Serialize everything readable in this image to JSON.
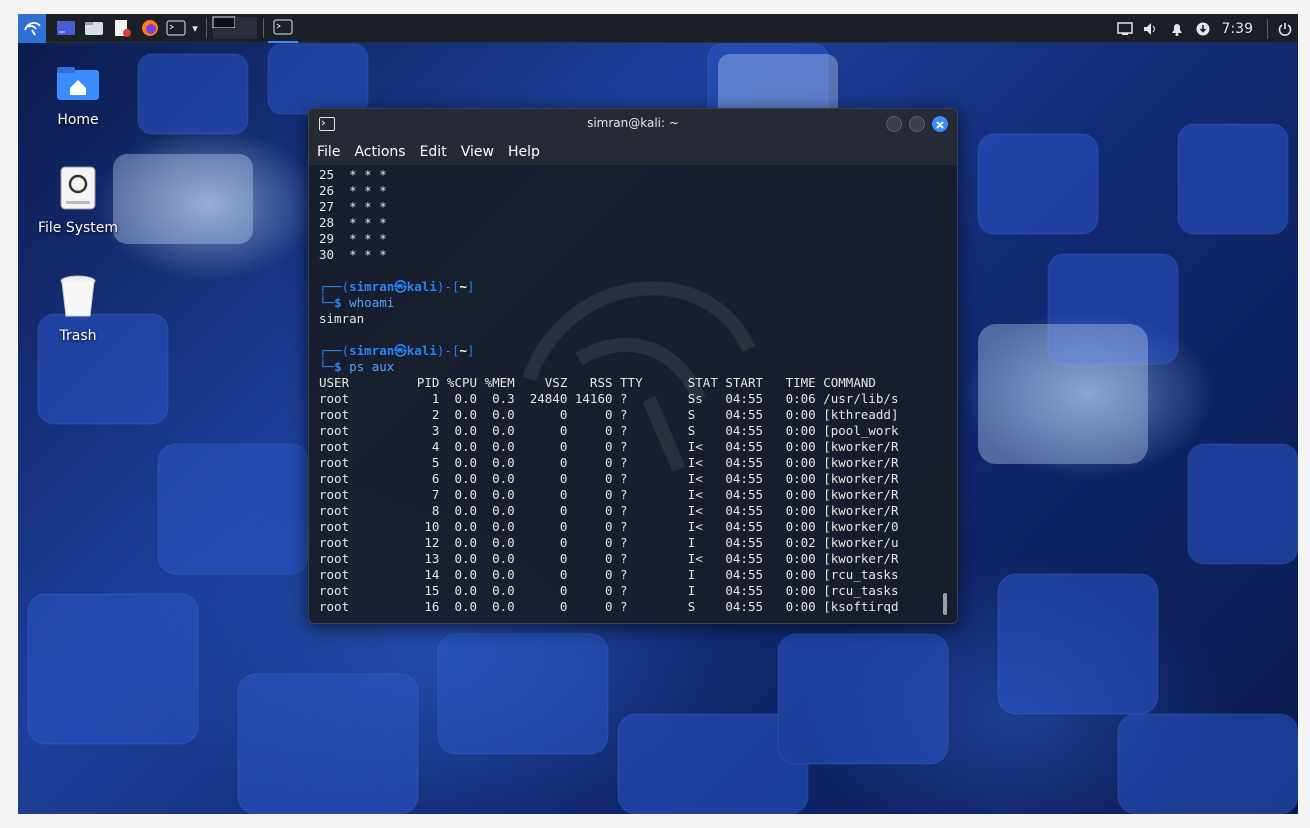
{
  "window": {
    "title": "simran@kali: ~",
    "menu": [
      "File",
      "Actions",
      "Edit",
      "View",
      "Help"
    ]
  },
  "panel": {
    "clock": "7:39"
  },
  "desktop_icons": [
    {
      "label": "Home",
      "icon": "home-folder-icon"
    },
    {
      "label": "File System",
      "icon": "drive-icon"
    },
    {
      "label": "Trash",
      "icon": "trash-icon"
    }
  ],
  "terminal": {
    "pattern_lines": [
      "25  * * *",
      "26  * * *",
      "27  * * *",
      "28  * * *",
      "29  * * *",
      "30  * * *"
    ],
    "prompt_user": "simran",
    "prompt_host": "kali",
    "prompt_dir": "~",
    "prompt1_cmd": "whoami",
    "output1": "simran",
    "prompt2_cmd": "ps aux",
    "ps_header": "USER         PID %CPU %MEM    VSZ   RSS TTY      STAT START   TIME COMMAND",
    "ps_rows": [
      "root           1  0.0  0.3  24840 14160 ?        Ss   04:55   0:06 /usr/lib/s",
      "root           2  0.0  0.0      0     0 ?        S    04:55   0:00 [kthreadd]",
      "root           3  0.0  0.0      0     0 ?        S    04:55   0:00 [pool_work",
      "root           4  0.0  0.0      0     0 ?        I<   04:55   0:00 [kworker/R",
      "root           5  0.0  0.0      0     0 ?        I<   04:55   0:00 [kworker/R",
      "root           6  0.0  0.0      0     0 ?        I<   04:55   0:00 [kworker/R",
      "root           7  0.0  0.0      0     0 ?        I<   04:55   0:00 [kworker/R",
      "root           8  0.0  0.0      0     0 ?        I<   04:55   0:00 [kworker/R",
      "root          10  0.0  0.0      0     0 ?        I<   04:55   0:00 [kworker/0",
      "root          12  0.0  0.0      0     0 ?        I    04:55   0:02 [kworker/u",
      "root          13  0.0  0.0      0     0 ?        I<   04:55   0:00 [kworker/R",
      "root          14  0.0  0.0      0     0 ?        I    04:55   0:00 [rcu_tasks",
      "root          15  0.0  0.0      0     0 ?        I    04:55   0:00 [rcu_tasks",
      "root          16  0.0  0.0      0     0 ?        S    04:55   0:00 [ksoftirqd"
    ]
  }
}
